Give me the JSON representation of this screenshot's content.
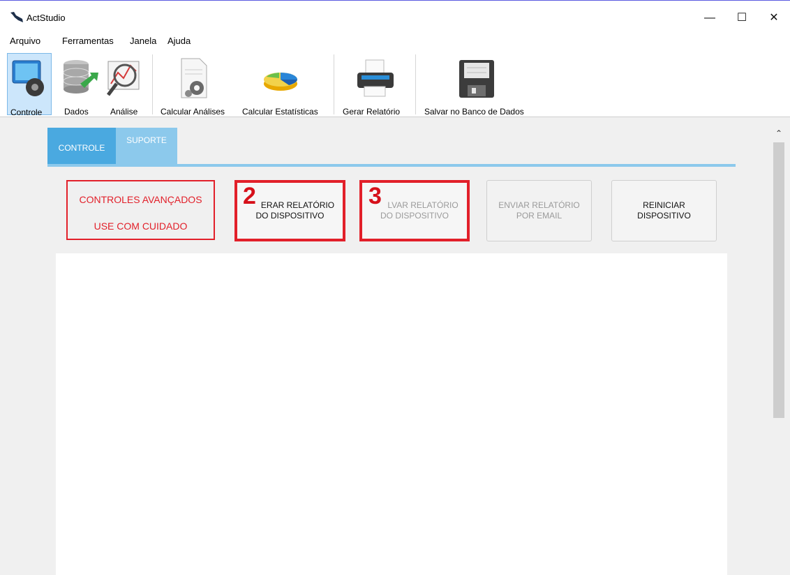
{
  "window": {
    "title": "ActStudio",
    "logo_icon": "eagle-logo-icon"
  },
  "menu": [
    "Arquivo",
    "Ferramentas",
    "Janela",
    "Ajuda"
  ],
  "toolbar": [
    {
      "label": "Controle",
      "icon": "controle-icon",
      "selected": true
    },
    {
      "label": "Dados",
      "icon": "database-icon"
    },
    {
      "label": "Análise",
      "icon": "chart-magnifier-icon"
    },
    {
      "label": "Calcular Análises",
      "icon": "document-gear-icon"
    },
    {
      "label": "Calcular Estatísticas",
      "icon": "pie-chart-icon"
    },
    {
      "label": "Gerar Relatório",
      "icon": "printer-icon"
    },
    {
      "label": "Salvar no Banco de Dados",
      "icon": "floppy-disk-icon"
    }
  ],
  "tabs": [
    {
      "label": "CONTROLE",
      "active": true
    },
    {
      "label": "SUPORTE",
      "active": false
    }
  ],
  "warning": {
    "line1": "CONTROLES AVANÇADOS",
    "line2": "USE COM CUIDADO",
    "color": "#e2202a"
  },
  "buttons": {
    "gerar": {
      "line1": "ERAR RELATÓRIO",
      "line2": "DO DISPOSITIVO",
      "step": "2"
    },
    "salvar": {
      "line1": "LVAR RELATÓRIO",
      "line2": "DO DISPOSITIVO",
      "step": "3",
      "enabled": false
    },
    "enviar": {
      "line1": "ENVIAR RELATÓRIO",
      "line2": "POR EMAIL",
      "enabled": false
    },
    "reiniciar": {
      "line1": "REINICIAR",
      "line2": "DISPOSITIVO"
    }
  },
  "colors": {
    "accent": "#4aa9e0",
    "tab_light": "#8cc9ec",
    "highlight": "#e2202a"
  }
}
